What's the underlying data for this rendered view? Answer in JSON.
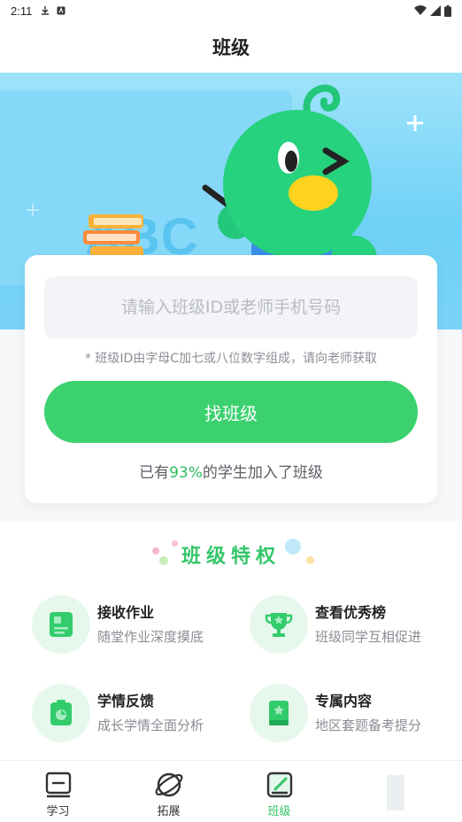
{
  "status_bar": {
    "time": "2:11"
  },
  "header": {
    "title": "班级"
  },
  "hero": {
    "board_text": "ABC"
  },
  "join_card": {
    "input_placeholder": "请输入班级ID或老师手机号码",
    "input_value": "",
    "hint": "* 班级ID由字母C加七或八位数字组成，请向老师获取",
    "find_button": "找班级",
    "joined_prefix": "已有",
    "joined_percent": "93%",
    "joined_suffix": "的学生加入了班级"
  },
  "privileges": {
    "title": "班级特权",
    "items": [
      {
        "title": "接收作业",
        "subtitle": "随堂作业深度摸底",
        "icon": "homework-icon"
      },
      {
        "title": "查看优秀榜",
        "subtitle": "班级同学互相促进",
        "icon": "trophy-icon"
      },
      {
        "title": "学情反馈",
        "subtitle": "成长学情全面分析",
        "icon": "report-icon"
      },
      {
        "title": "专属内容",
        "subtitle": "地区套题备考提分",
        "icon": "book-icon"
      }
    ]
  },
  "bottom_nav": {
    "items": [
      {
        "label": "学习",
        "icon": "study-icon",
        "active": false
      },
      {
        "label": "拓展",
        "icon": "planet-icon",
        "active": false
      },
      {
        "label": "班级",
        "icon": "class-icon",
        "active": true
      }
    ]
  },
  "colors": {
    "accent": "#3bd16f",
    "hero_bg": "#8bdaf8",
    "title_green": "#35c66a"
  }
}
